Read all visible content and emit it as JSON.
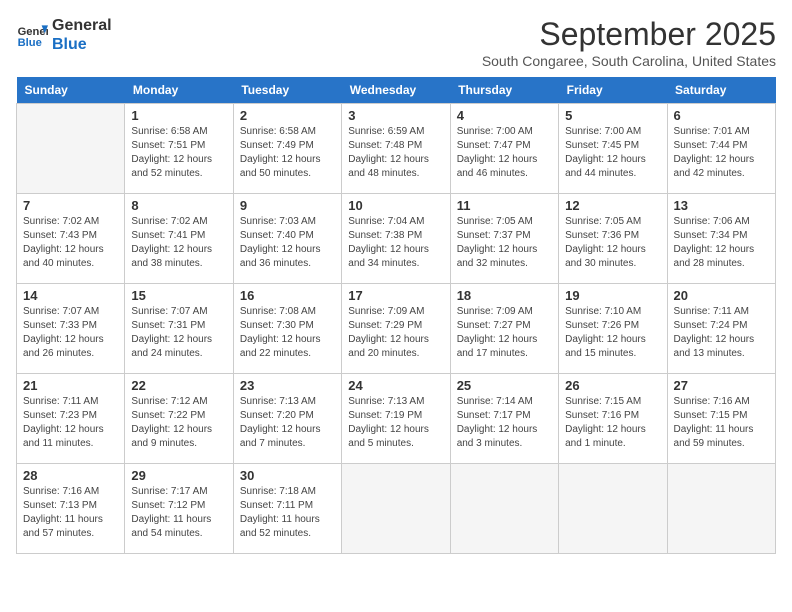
{
  "header": {
    "logo_line1": "General",
    "logo_line2": "Blue",
    "month_year": "September 2025",
    "location": "South Congaree, South Carolina, United States"
  },
  "days_of_week": [
    "Sunday",
    "Monday",
    "Tuesday",
    "Wednesday",
    "Thursday",
    "Friday",
    "Saturday"
  ],
  "weeks": [
    [
      {
        "day": "",
        "info": ""
      },
      {
        "day": "1",
        "info": "Sunrise: 6:58 AM\nSunset: 7:51 PM\nDaylight: 12 hours\nand 52 minutes."
      },
      {
        "day": "2",
        "info": "Sunrise: 6:58 AM\nSunset: 7:49 PM\nDaylight: 12 hours\nand 50 minutes."
      },
      {
        "day": "3",
        "info": "Sunrise: 6:59 AM\nSunset: 7:48 PM\nDaylight: 12 hours\nand 48 minutes."
      },
      {
        "day": "4",
        "info": "Sunrise: 7:00 AM\nSunset: 7:47 PM\nDaylight: 12 hours\nand 46 minutes."
      },
      {
        "day": "5",
        "info": "Sunrise: 7:00 AM\nSunset: 7:45 PM\nDaylight: 12 hours\nand 44 minutes."
      },
      {
        "day": "6",
        "info": "Sunrise: 7:01 AM\nSunset: 7:44 PM\nDaylight: 12 hours\nand 42 minutes."
      }
    ],
    [
      {
        "day": "7",
        "info": "Sunrise: 7:02 AM\nSunset: 7:43 PM\nDaylight: 12 hours\nand 40 minutes."
      },
      {
        "day": "8",
        "info": "Sunrise: 7:02 AM\nSunset: 7:41 PM\nDaylight: 12 hours\nand 38 minutes."
      },
      {
        "day": "9",
        "info": "Sunrise: 7:03 AM\nSunset: 7:40 PM\nDaylight: 12 hours\nand 36 minutes."
      },
      {
        "day": "10",
        "info": "Sunrise: 7:04 AM\nSunset: 7:38 PM\nDaylight: 12 hours\nand 34 minutes."
      },
      {
        "day": "11",
        "info": "Sunrise: 7:05 AM\nSunset: 7:37 PM\nDaylight: 12 hours\nand 32 minutes."
      },
      {
        "day": "12",
        "info": "Sunrise: 7:05 AM\nSunset: 7:36 PM\nDaylight: 12 hours\nand 30 minutes."
      },
      {
        "day": "13",
        "info": "Sunrise: 7:06 AM\nSunset: 7:34 PM\nDaylight: 12 hours\nand 28 minutes."
      }
    ],
    [
      {
        "day": "14",
        "info": "Sunrise: 7:07 AM\nSunset: 7:33 PM\nDaylight: 12 hours\nand 26 minutes."
      },
      {
        "day": "15",
        "info": "Sunrise: 7:07 AM\nSunset: 7:31 PM\nDaylight: 12 hours\nand 24 minutes."
      },
      {
        "day": "16",
        "info": "Sunrise: 7:08 AM\nSunset: 7:30 PM\nDaylight: 12 hours\nand 22 minutes."
      },
      {
        "day": "17",
        "info": "Sunrise: 7:09 AM\nSunset: 7:29 PM\nDaylight: 12 hours\nand 20 minutes."
      },
      {
        "day": "18",
        "info": "Sunrise: 7:09 AM\nSunset: 7:27 PM\nDaylight: 12 hours\nand 17 minutes."
      },
      {
        "day": "19",
        "info": "Sunrise: 7:10 AM\nSunset: 7:26 PM\nDaylight: 12 hours\nand 15 minutes."
      },
      {
        "day": "20",
        "info": "Sunrise: 7:11 AM\nSunset: 7:24 PM\nDaylight: 12 hours\nand 13 minutes."
      }
    ],
    [
      {
        "day": "21",
        "info": "Sunrise: 7:11 AM\nSunset: 7:23 PM\nDaylight: 12 hours\nand 11 minutes."
      },
      {
        "day": "22",
        "info": "Sunrise: 7:12 AM\nSunset: 7:22 PM\nDaylight: 12 hours\nand 9 minutes."
      },
      {
        "day": "23",
        "info": "Sunrise: 7:13 AM\nSunset: 7:20 PM\nDaylight: 12 hours\nand 7 minutes."
      },
      {
        "day": "24",
        "info": "Sunrise: 7:13 AM\nSunset: 7:19 PM\nDaylight: 12 hours\nand 5 minutes."
      },
      {
        "day": "25",
        "info": "Sunrise: 7:14 AM\nSunset: 7:17 PM\nDaylight: 12 hours\nand 3 minutes."
      },
      {
        "day": "26",
        "info": "Sunrise: 7:15 AM\nSunset: 7:16 PM\nDaylight: 12 hours\nand 1 minute."
      },
      {
        "day": "27",
        "info": "Sunrise: 7:16 AM\nSunset: 7:15 PM\nDaylight: 11 hours\nand 59 minutes."
      }
    ],
    [
      {
        "day": "28",
        "info": "Sunrise: 7:16 AM\nSunset: 7:13 PM\nDaylight: 11 hours\nand 57 minutes."
      },
      {
        "day": "29",
        "info": "Sunrise: 7:17 AM\nSunset: 7:12 PM\nDaylight: 11 hours\nand 54 minutes."
      },
      {
        "day": "30",
        "info": "Sunrise: 7:18 AM\nSunset: 7:11 PM\nDaylight: 11 hours\nand 52 minutes."
      },
      {
        "day": "",
        "info": ""
      },
      {
        "day": "",
        "info": ""
      },
      {
        "day": "",
        "info": ""
      },
      {
        "day": "",
        "info": ""
      }
    ]
  ]
}
